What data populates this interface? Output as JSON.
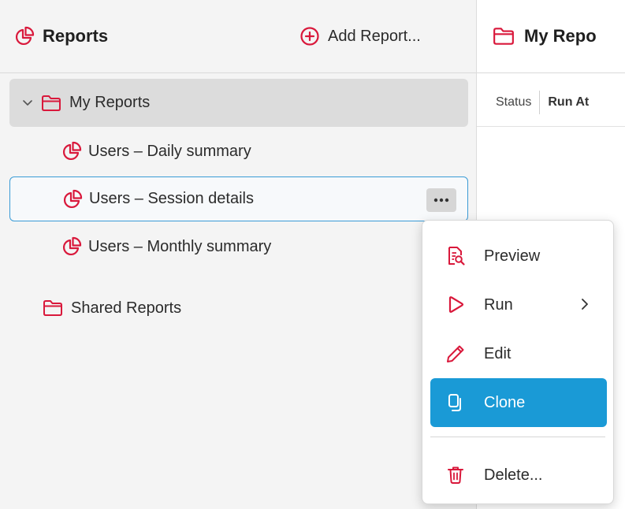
{
  "colors": {
    "accent": "#d9183b",
    "selection_blue": "#1a9ad6",
    "selected_row_border": "#3a9bd6"
  },
  "left_panel": {
    "title": "Reports",
    "title_icon": "pie-chart-icon",
    "add_button": {
      "label": "Add Report...",
      "icon": "plus-circle-icon"
    }
  },
  "tree": {
    "my_reports": {
      "label": "My Reports",
      "expanded": true,
      "icon": "folder-icon",
      "items": [
        {
          "label": "Users – Daily summary",
          "icon": "pie-chart-icon"
        },
        {
          "label": "Users – Session details",
          "icon": "pie-chart-icon",
          "selected": true
        },
        {
          "label": "Users – Monthly summary",
          "icon": "pie-chart-icon"
        }
      ]
    },
    "shared_reports": {
      "label": "Shared Reports",
      "icon": "folder-icon"
    },
    "more_button_icon": "ellipsis-icon"
  },
  "right_panel": {
    "title": "My Repo",
    "title_icon": "folder-icon",
    "columns": [
      "Status",
      "Run At"
    ]
  },
  "context_menu": {
    "items": [
      {
        "label": "Preview",
        "icon": "preview-document-icon"
      },
      {
        "label": "Run",
        "icon": "play-icon",
        "has_submenu": true
      },
      {
        "label": "Edit",
        "icon": "pencil-icon"
      },
      {
        "label": "Clone",
        "icon": "copy-icon",
        "highlighted": true
      },
      {
        "label": "Delete...",
        "icon": "trash-icon"
      }
    ]
  }
}
